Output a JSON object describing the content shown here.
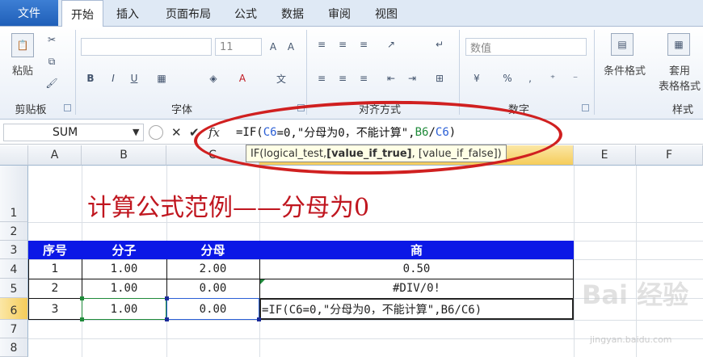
{
  "ribbon": {
    "file_tab": "文件",
    "tabs": [
      "开始",
      "插入",
      "页面布局",
      "公式",
      "数据",
      "审阅",
      "视图"
    ],
    "groups": {
      "clipboard": {
        "label": "剪贴板",
        "paste": "粘贴"
      },
      "font": {
        "label": "字体",
        "font_size": "11"
      },
      "alignment": {
        "label": "对齐方式"
      },
      "number": {
        "label": "数字",
        "format": "数值"
      },
      "styles": {
        "label": "样式",
        "conditional": "条件格式",
        "table_line1": "套用",
        "table_line2": "表格格式"
      }
    }
  },
  "formula_bar": {
    "name_box": "SUM",
    "fx": "fx",
    "formula_prefix": "=IF(",
    "ref_c6": "C6",
    "formula_middle": "=0,\"分母为0，不能计算\",",
    "ref_b6": "B6",
    "formula_slash": "/",
    "ref_c6b": "C6",
    "formula_suffix": ")",
    "tooltip_a": "IF(logical_test, ",
    "tooltip_b": "[value_if_true]",
    "tooltip_c": ", [value_if_false])"
  },
  "columns": [
    "A",
    "B",
    "C",
    "D",
    "E",
    "F"
  ],
  "rows": [
    "1",
    "2",
    "3",
    "4",
    "5",
    "6",
    "7",
    "8"
  ],
  "sheet": {
    "title": "计算公式范例——分母为0",
    "headers": [
      "序号",
      "分子",
      "分母",
      "商"
    ],
    "data": [
      [
        "1",
        "1.00",
        "2.00",
        "0.50"
      ],
      [
        "2",
        "1.00",
        "0.00",
        "#DIV/0!"
      ],
      [
        "3",
        "1.00",
        "0.00",
        "=IF(C6=0,\"分母为0，不能计算\",B6/C6)"
      ]
    ]
  },
  "watermark": {
    "main": "Bai 经验",
    "sub": "jingyan.baidu.com"
  },
  "colors": {
    "header_fill": "#0b18e6",
    "title": "#c0161f",
    "ref_c6": "#2a5fd6",
    "ref_b6": "#1f8a3a",
    "oval": "#d02020"
  }
}
